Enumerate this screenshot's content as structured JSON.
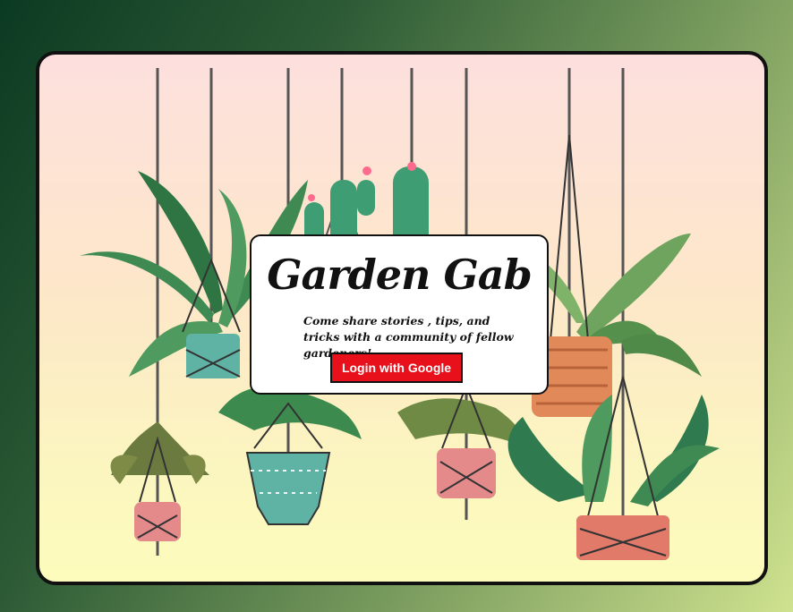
{
  "app": {
    "title": "Garden Gab",
    "tagline": "Come share stories , tips, and tricks with a community of fellow gardeners!",
    "login_label": "Login with Google"
  },
  "colors": {
    "background_dark": "#0b3a22",
    "background_light": "#cfe28f",
    "panel_top": "#fde0de",
    "panel_bottom": "#fdfcbc",
    "button": "#e8101b",
    "leaf_green": "#3e8a52",
    "pot_pink": "#e58a8a",
    "pot_teal": "#5fb3a5",
    "pot_orange": "#e2895a"
  },
  "illustration": {
    "name": "hanging-macrame-planters"
  }
}
